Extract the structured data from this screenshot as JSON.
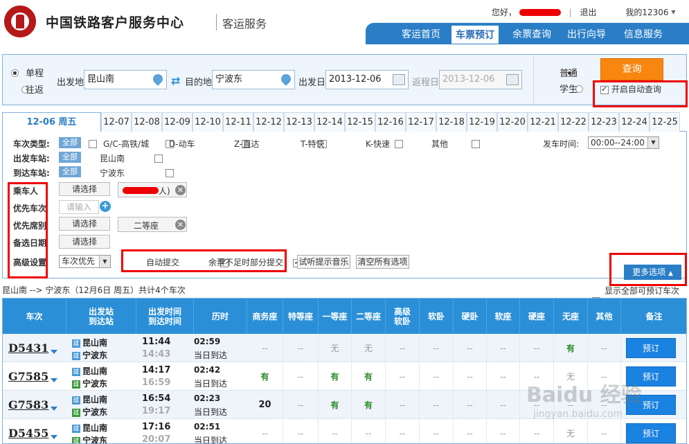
{
  "header": {
    "brand": "中国铁路客户服务中心",
    "brand_sub": "客运服务",
    "greeting": "您好，",
    "logout": "退出",
    "my_account": "我的12306",
    "nav": [
      "客运首页",
      "车票预订",
      "余票查询",
      "出行向导",
      "信息服务"
    ]
  },
  "search": {
    "trip_types": [
      "单程",
      "往返"
    ],
    "from_label": "出发地",
    "from_value": "昆山南",
    "to_label": "目的地",
    "to_value": "宁波东",
    "date_label": "出发日",
    "date_value": "2013-12-06",
    "return_label": "返程日",
    "return_value": "2013-12-06",
    "passenger_types": [
      "普通",
      "学生"
    ],
    "query_button": "查询",
    "auto_query_label": "开启自动查询"
  },
  "date_tabs": {
    "active": "12-06 周五",
    "dates": [
      "12-07",
      "12-08",
      "12-09",
      "12-10",
      "12-11",
      "12-12",
      "12-13",
      "12-14",
      "12-15",
      "12-16",
      "12-17",
      "12-18",
      "12-19",
      "12-20",
      "12-21",
      "12-22",
      "12-23",
      "12-24",
      "12-25"
    ]
  },
  "filters": {
    "train_type_label": "车次类型:",
    "all": "全部",
    "train_types": [
      "G/C-高铁/城",
      "D-动车",
      "Z-直达",
      "T-特快",
      "K-快速",
      "其他"
    ],
    "depart_time_label": "发车时间:",
    "depart_time_value": "00:00--24:00",
    "from_station_label": "出发车站:",
    "from_station": "昆山南",
    "to_station_label": "到达车站:",
    "to_station": "宁波东",
    "passenger_label": "乘车人",
    "choose": "请选择",
    "passenger_tag": "人)",
    "priority_train_label": "优先车次",
    "priority_train_placeholder": "请输入",
    "priority_seat_label": "优先席别",
    "seat_tag": "二等座",
    "backup_date_label": "备选日期",
    "advanced_label": "高级设置",
    "order_select": "车次优先",
    "auto_submit": "自动提交",
    "partial_submit": "余票不足时部分提交",
    "test_music": "试听提示音乐",
    "clear_all": "清空所有选项",
    "more_options": "更多选项"
  },
  "results": {
    "route_summary": "昆山南 --> 宁波东（12月6日  周五）共计4个车次",
    "show_all_label": "显示全部可预订车次",
    "columns": [
      "车次",
      "出发站\n到达站",
      "出发时间\n到达时间",
      "历时",
      "商务座",
      "特等座",
      "一等座",
      "二等座",
      "高级\n软卧",
      "软卧",
      "硬卧",
      "软座",
      "硬座",
      "无座",
      "其他",
      "备注"
    ],
    "book_label": "预订",
    "rows": [
      {
        "train": "D5431",
        "from": "昆山南",
        "to": "宁波东",
        "dep": "11:44",
        "arr": "14:43",
        "dur": "02:59",
        "arrive_note": "当日到达",
        "seats": [
          "--",
          "--",
          "无",
          "无",
          "--",
          "--",
          "--",
          "--",
          "--",
          "有",
          "--"
        ]
      },
      {
        "train": "G7585",
        "from": "昆山南",
        "to": "宁波东",
        "dep": "14:17",
        "arr": "16:59",
        "dur": "02:42",
        "arrive_note": "当日到达",
        "seats": [
          "有",
          "--",
          "有",
          "有",
          "--",
          "--",
          "--",
          "--",
          "--",
          "无",
          "--"
        ]
      },
      {
        "train": "G7583",
        "from": "昆山南",
        "to": "宁波东",
        "dep": "16:54",
        "arr": "19:17",
        "dur": "02:23",
        "arrive_note": "当日到达",
        "seats": [
          "20",
          "--",
          "有",
          "有",
          "--",
          "--",
          "--",
          "--",
          "--",
          "--",
          "--"
        ]
      },
      {
        "train": "D5455",
        "from": "昆山南",
        "to": "宁波东",
        "dep": "17:16",
        "arr": "20:07",
        "dur": "02:51",
        "arrive_note": "当日到达",
        "seats": [
          "--",
          "--",
          "--",
          "--",
          "--",
          "--",
          "--",
          "--",
          "--",
          "无",
          "--"
        ]
      }
    ]
  },
  "watermark": {
    "text": "Baidu 经验",
    "sub": "jingyan.baidu.com"
  },
  "colors": {
    "brand_red": "#b5191a",
    "nav_blue": "#2a7ec6",
    "query_orange": "#f8860f",
    "table_head": "#2a8fd6",
    "available_green": "#2a8a2a",
    "annotation_red": "#e00000"
  }
}
